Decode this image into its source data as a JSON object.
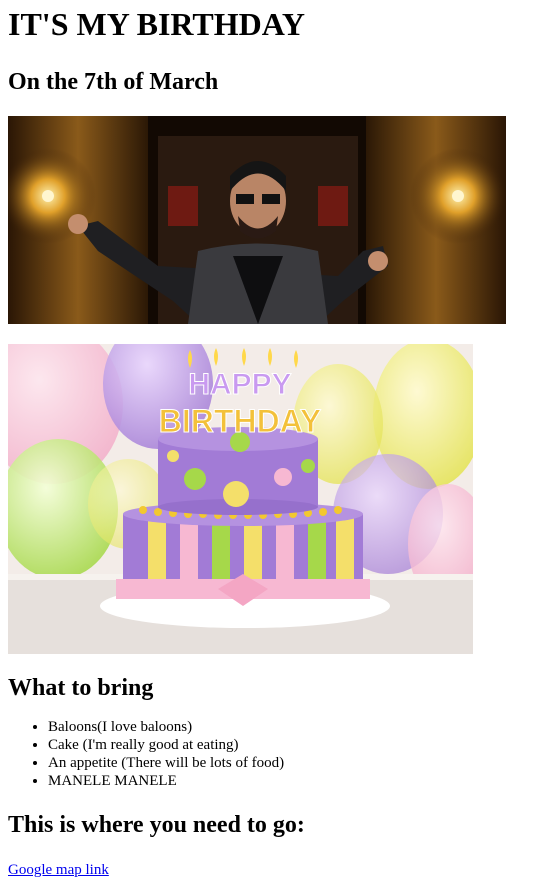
{
  "header": {
    "title": "IT'S MY BIRTHDAY",
    "subtitle": "On the 7th of March"
  },
  "images": {
    "singer_icon": "man-with-sunglasses-photo",
    "cake_icon": "birthday-cake-photo",
    "cake_candles_text": "HAPPY BIRTHDAY"
  },
  "bring": {
    "title": "What to bring",
    "items": [
      "Baloons(I love baloons)",
      "Cake (I'm really good at eating)",
      "An appetite (There will be lots of food)",
      "MANELE MANELE"
    ]
  },
  "location": {
    "title": "This is where you need to go:",
    "link_text": "Google map link"
  },
  "colors": {
    "link": "#0000ee",
    "text": "#000000",
    "background": "#ffffff"
  }
}
